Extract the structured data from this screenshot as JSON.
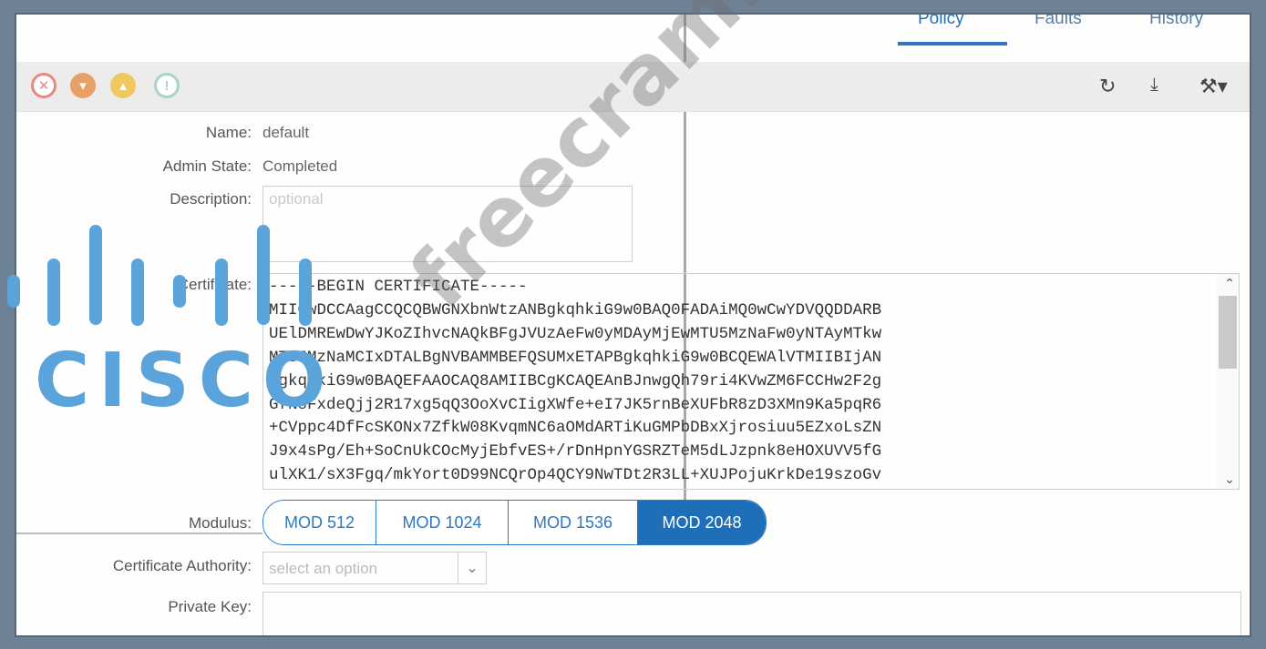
{
  "tabs": [
    "Policy",
    "Faults",
    "History"
  ],
  "tabs_active": "Policy",
  "toolbar": {
    "fault_icons": [
      {
        "name": "critical-fault-icon",
        "color": "#e58a7e",
        "glyph": "⊗"
      },
      {
        "name": "major-fault-icon",
        "color": "#e7a066",
        "glyph": "▽"
      },
      {
        "name": "minor-fault-icon",
        "color": "#efc85f",
        "glyph": "△"
      },
      {
        "name": "warning-fault-icon",
        "color": "#a9d3cc",
        "glyph": "ⓘ"
      }
    ],
    "actions": [
      "refresh-icon",
      "download-icon",
      "tools-icon"
    ]
  },
  "form": {
    "name_label": "Name:",
    "name_value": "default",
    "admin_state_label": "Admin State:",
    "admin_state_value": "Completed",
    "description_label": "Description:",
    "description_placeholder": "optional",
    "certificate_label": "Certificate:",
    "certificate_text": "-----BEGIN CERTIFICATE-----\nMIICwDCCAagCCQCQBWGNXbnWtzANBgkqhkiG9w0BAQ0FADAiMQ0wCwYDVQQDDARB\nUElDMREwDwYJKoZIhvcNAQkBFgJVUzAeFw0yMDAyMjEwMTU5MzNaFw0yNTAyMTkw\nMTU5MzNaMCIxDTALBgNVBAMMBEFQSUMxETAPBgkqhkiG9w0BCQEWAlVTMIIBIjAN\nBgkqhkiG9w0BAQEFAAOCAQ8AMIIBCgKCAQEAnBJnwgQh79ri4KVwZM6FCCHw2F2g\nGfNsFxdeQjj2R17xg5qQ3OoXvCIigXWfe+eI7JK5rnBeXUFbR8zD3XMn9Ka5pqR6\n+CVppc4DfFcSKONx7ZfkW08KvqmNC6aOMdARTiKuGMPbDBxXjrosiuu5EZxoLsZN\nJ9x4sPg/Eh+SoCnUkCOcMyjEbfvES+/rDnHpnYGSRZTeM5dLJzpnk8eHOXUVV5fG\nulXK1/sX3Fgq/mkYort0D99NCQrOp4QCY9NwTDt2R3LL+XUJPojuKrkDe19szoGv",
    "modulus_label": "Modulus:",
    "modulus_options": [
      "MOD 512",
      "MOD 1024",
      "MOD 1536",
      "MOD 2048"
    ],
    "modulus_selected": "MOD 2048",
    "ca_label": "Certificate Authority:",
    "ca_placeholder": "select an option",
    "private_key_label": "Private Key:"
  },
  "overlay": {
    "logo_text": "CISCO",
    "logo_color": "#5ba4db",
    "watermark_text": "freecram.net"
  }
}
